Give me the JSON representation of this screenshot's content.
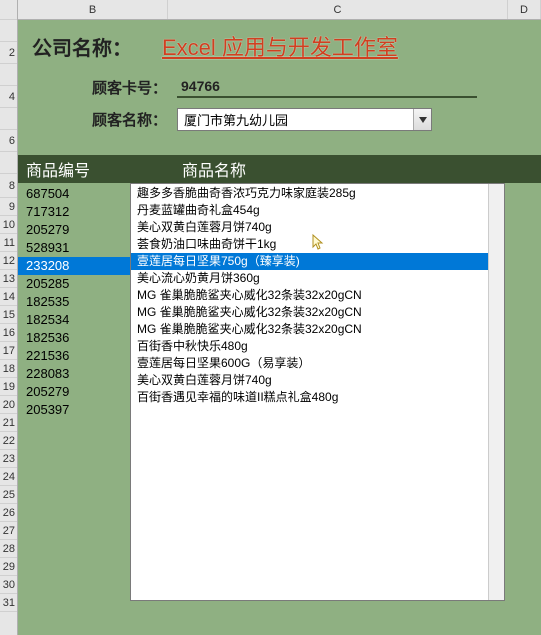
{
  "columns": [
    "B",
    "C",
    "D"
  ],
  "rows_first_block": [
    "",
    "2",
    "",
    "4",
    "",
    "6",
    ""
  ],
  "rows_second_block": [
    "9",
    "10",
    "11",
    "12",
    "13",
    "14",
    "15",
    "16",
    "17",
    "18",
    "19",
    "20",
    "21",
    "22",
    "23",
    "24",
    "25",
    "26",
    "27",
    "28",
    "29",
    "30",
    "31"
  ],
  "row8_label": "8",
  "company": {
    "label": "公司名称：",
    "name": "Excel 应用与开发工作室"
  },
  "card": {
    "label": "顾客卡号：",
    "value": "94766"
  },
  "customer": {
    "label": "顾客名称：",
    "value": "厦门市第九幼儿园"
  },
  "table": {
    "header_code": "商品编号",
    "header_name": "商品名称"
  },
  "codes": [
    "687504",
    "717312",
    "205279",
    "528931",
    "233208",
    "205285",
    "182535",
    "182534",
    "182536",
    "221536",
    "228083",
    "205279",
    "205397"
  ],
  "selected_code_index": 4,
  "products": [
    "趣多多香脆曲奇香浓巧克力味家庭装285g",
    "丹麦蓝罐曲奇礼盒454g",
    "美心双黄白莲蓉月饼740g",
    "荟食奶油口味曲奇饼干1kg",
    "壹莲居每日坚果750g（臻享装)",
    "美心流心奶黄月饼360g",
    "MG 雀巢脆脆鲨夹心威化32条装32x20gCN",
    "MG 雀巢脆脆鲨夹心威化32条装32x20gCN",
    "MG 雀巢脆脆鲨夹心威化32条装32x20gCN",
    "百街香中秋快乐480g",
    "壹莲居每日坚果600G（易享装）",
    "美心双黄白莲蓉月饼740g",
    "百街香遇见幸福的味道II糕点礼盒480g"
  ],
  "selected_product_index": 4
}
